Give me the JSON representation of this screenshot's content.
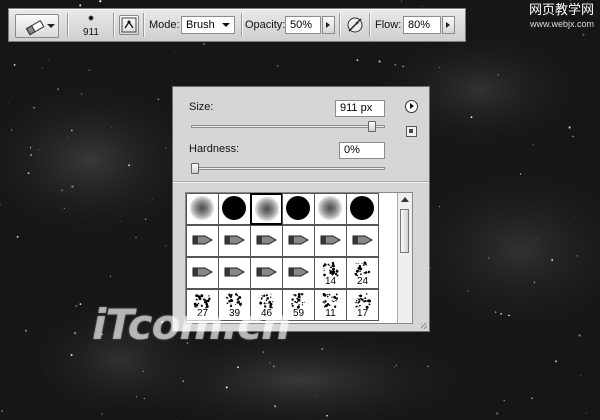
{
  "options_bar": {
    "brush_size": "911",
    "mode_label": "Mode:",
    "mode_value": "Brush",
    "opacity_label": "Opacity:",
    "opacity_value": "50%",
    "flow_label": "Flow:",
    "flow_value": "80%",
    "icons": [
      "eraser-icon",
      "brush-preset-picker-icon",
      "toggle-brush-panel-icon",
      "airbrush-icon"
    ]
  },
  "watermark": {
    "top_text": "网页教学网",
    "top_url": "www.webjx.com",
    "logo_text": "iT.com.cn"
  },
  "brush_panel": {
    "size_label": "Size:",
    "size_value": "911 px",
    "size_level": 0.95,
    "hardness_label": "Hardness:",
    "hardness_value": "0%",
    "hardness_level": 0.0,
    "brushes": [
      {
        "kind": "soft",
        "label": ""
      },
      {
        "kind": "hard",
        "label": ""
      },
      {
        "kind": "soft",
        "label": "",
        "selected": true
      },
      {
        "kind": "hard",
        "label": ""
      },
      {
        "kind": "soft",
        "label": ""
      },
      {
        "kind": "hard",
        "label": ""
      },
      {
        "kind": "tip",
        "label": ""
      },
      {
        "kind": "tip",
        "label": ""
      },
      {
        "kind": "tip",
        "label": ""
      },
      {
        "kind": "tip",
        "label": ""
      },
      {
        "kind": "tip",
        "label": ""
      },
      {
        "kind": "tip",
        "label": ""
      },
      {
        "kind": "tip",
        "label": ""
      },
      {
        "kind": "tip",
        "label": ""
      },
      {
        "kind": "tip",
        "label": ""
      },
      {
        "kind": "tip",
        "label": ""
      },
      {
        "kind": "scatter",
        "label": "14"
      },
      {
        "kind": "scatter",
        "label": "24"
      },
      {
        "kind": "scatter",
        "label": "27"
      },
      {
        "kind": "scatter",
        "label": "39"
      },
      {
        "kind": "scatter",
        "label": "46"
      },
      {
        "kind": "scatter",
        "label": "59"
      },
      {
        "kind": "scatter",
        "label": "11"
      },
      {
        "kind": "scatter",
        "label": "17"
      }
    ]
  }
}
